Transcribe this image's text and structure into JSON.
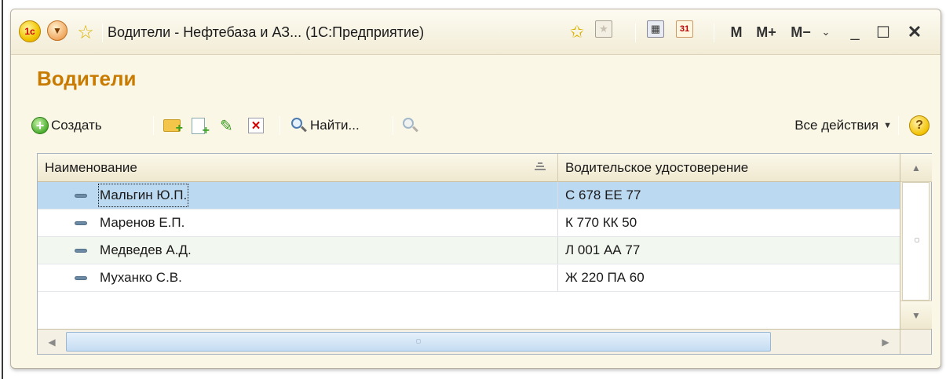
{
  "window": {
    "title": "Водители - Нефтебаза и АЗ...  (1С:Предприятие)",
    "logo_text": "1c",
    "memory_buttons": [
      "M",
      "M+",
      "M−"
    ],
    "calendar_day": "31"
  },
  "form": {
    "title": "Водители"
  },
  "toolbar": {
    "create_label": "Создать",
    "find_label": "Найти...",
    "all_actions_label": "Все действия",
    "help_label": "?"
  },
  "table": {
    "columns": [
      "Наименование",
      "Водительское удостоверение"
    ],
    "rows": [
      {
        "name": "Мальгин Ю.П.",
        "license": "С 678 ЕЕ 77",
        "selected": true
      },
      {
        "name": "Маренов Е.П.",
        "license": "К 770 КК 50",
        "selected": false
      },
      {
        "name": "Медведев А.Д.",
        "license": "Л 001 АА 77",
        "selected": false
      },
      {
        "name": "Муханко С.В.",
        "license": "Ж 220 ПА 60",
        "selected": false
      }
    ]
  },
  "icons": {
    "favorite": "star-icon",
    "add_favorite": "star-add-icon",
    "calculator": "calculator-icon",
    "calendar": "calendar-icon",
    "create": "plus-circle-icon",
    "create_group": "folder-add-icon",
    "copy": "copy-icon",
    "edit": "pencil-icon",
    "delete": "delete-icon",
    "find": "magnifier-icon",
    "cancel_find": "cancel-search-icon",
    "help": "help-icon",
    "item": "item-icon"
  }
}
